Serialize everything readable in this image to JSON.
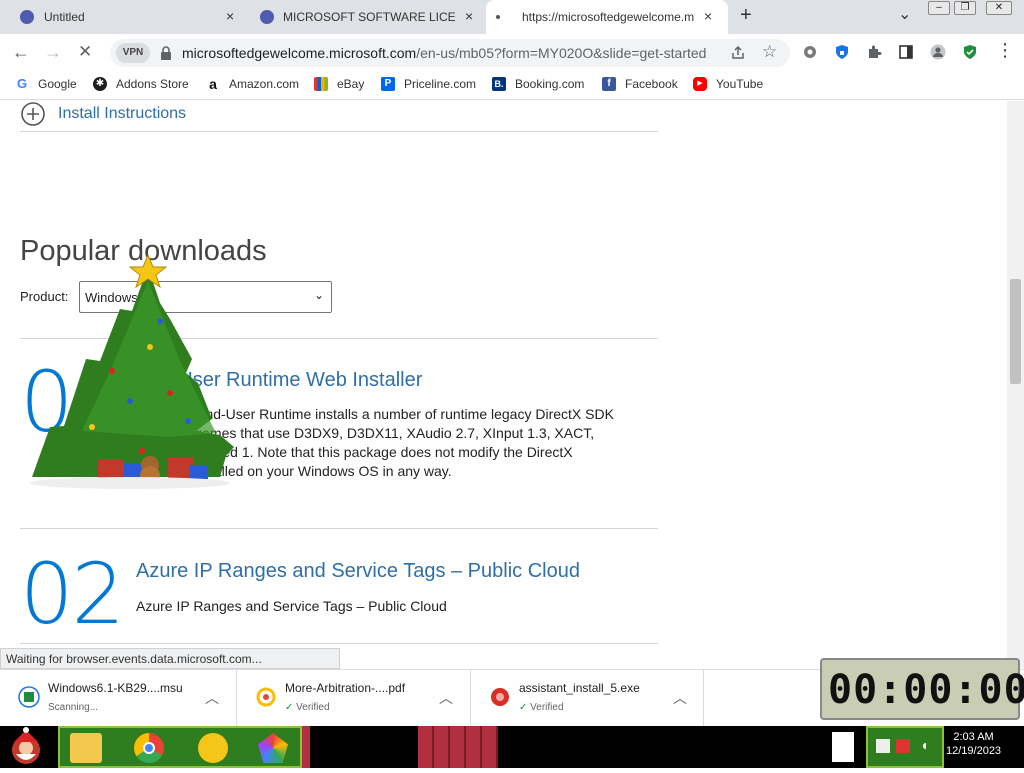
{
  "tabs": [
    {
      "title": "Untitled",
      "close": "×"
    },
    {
      "title": "MICROSOFT SOFTWARE LICENSE",
      "close": "×"
    },
    {
      "title": "https://microsoftedgewelcome.m",
      "close": "×"
    }
  ],
  "new_tab": "+",
  "tab_menu": "⌄",
  "window_controls": {
    "minimize": "‒",
    "maximize": "❐",
    "close": "✕"
  },
  "toolbar": {
    "vpn_label": "VPN",
    "url_host": "microsoftedgewelcome.microsoft.com",
    "url_rest": "/en-us/mb05?form=MY020O&slide=get-started"
  },
  "bookmarks": [
    {
      "label": "Google",
      "icon": "google-icon",
      "color": "#4285f4",
      "glyph": "G"
    },
    {
      "label": "Addons Store",
      "icon": "addons-store-icon",
      "color": "#1f1f1f",
      "glyph": "✱"
    },
    {
      "label": "Amazon.com",
      "icon": "amazon-icon",
      "color": "#ffffff",
      "glyph": "a"
    },
    {
      "label": "eBay",
      "icon": "ebay-icon",
      "color": "#e53238",
      "glyph": ""
    },
    {
      "label": "Priceline.com",
      "icon": "priceline-icon",
      "color": "#0068ef",
      "glyph": "P"
    },
    {
      "label": "Booking.com",
      "icon": "booking-icon",
      "color": "#003580",
      "glyph": "B."
    },
    {
      "label": "Facebook",
      "icon": "facebook-icon",
      "color": "#3b5998",
      "glyph": "f"
    },
    {
      "label": "YouTube",
      "icon": "youtube-icon",
      "color": "#ff0000",
      "glyph": "▶"
    }
  ],
  "page": {
    "install_instructions": "Install Instructions",
    "heading": "Popular downloads",
    "product_label": "Product:",
    "product_selected": "Windows",
    "downloads": [
      {
        "number": "01",
        "title": "End-User Runtime Web Installer",
        "desc": "DirectX® End-User Runtime installs a number of runtime legacy DirectX SDK for some games that use D3DX9, D3DX11, XAudio 2.7, XInput 1.3, XACT, and/or Managed 1. Note that this package does not modify the DirectX Runtime installed on your Windows OS in any way."
      },
      {
        "number": "02",
        "title": "Azure IP Ranges and Service Tags – Public Cloud",
        "desc": "Azure IP Ranges and Service Tags – Public Cloud"
      }
    ]
  },
  "status_text": "Waiting for browser.events.data.microsoft.com...",
  "downloads_bar": [
    {
      "filename": "Windows6.1-KB29....msu",
      "status": "Scanning...",
      "icon": "msu-file-icon"
    },
    {
      "filename": "More-Arbitration-....pdf",
      "status": "Verified",
      "icon": "pdf-file-icon"
    },
    {
      "filename": "assistant_install_5.exe",
      "status": "Verified",
      "icon": "exe-file-icon"
    }
  ],
  "timer": "00:00:00",
  "taskbar": {
    "time": "2:03 AM",
    "date": "12/19/2023"
  },
  "colors": {
    "accent_blue": "#0078d4",
    "link_blue": "#2f6fa7",
    "verified_green": "#1e8e3e"
  }
}
